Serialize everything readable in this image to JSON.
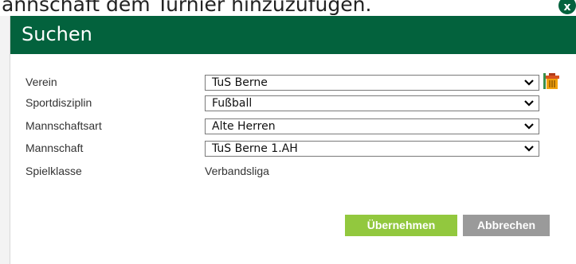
{
  "background": {
    "text": "annschaft dem Turnier hinzuzufügen."
  },
  "dialog": {
    "title": "Suchen",
    "close_label": "x",
    "fields": [
      {
        "label": "Verein",
        "value": "TuS Berne",
        "type": "select"
      },
      {
        "label": "Sportdisziplin",
        "value": "Fußball",
        "type": "select"
      },
      {
        "label": "Mannschaftsart",
        "value": "Alte Herren",
        "type": "select"
      },
      {
        "label": "Mannschaft",
        "value": "TuS Berne 1.AH",
        "type": "select"
      },
      {
        "label": "Spielklasse",
        "value": "Verbandsliga",
        "type": "static"
      }
    ],
    "buttons": {
      "ok": "Übernehmen",
      "cancel": "Abbrechen"
    }
  },
  "colors": {
    "titlebar": "#03623d",
    "ok_button": "#92c83e",
    "cancel_button": "#9a9a9a"
  }
}
